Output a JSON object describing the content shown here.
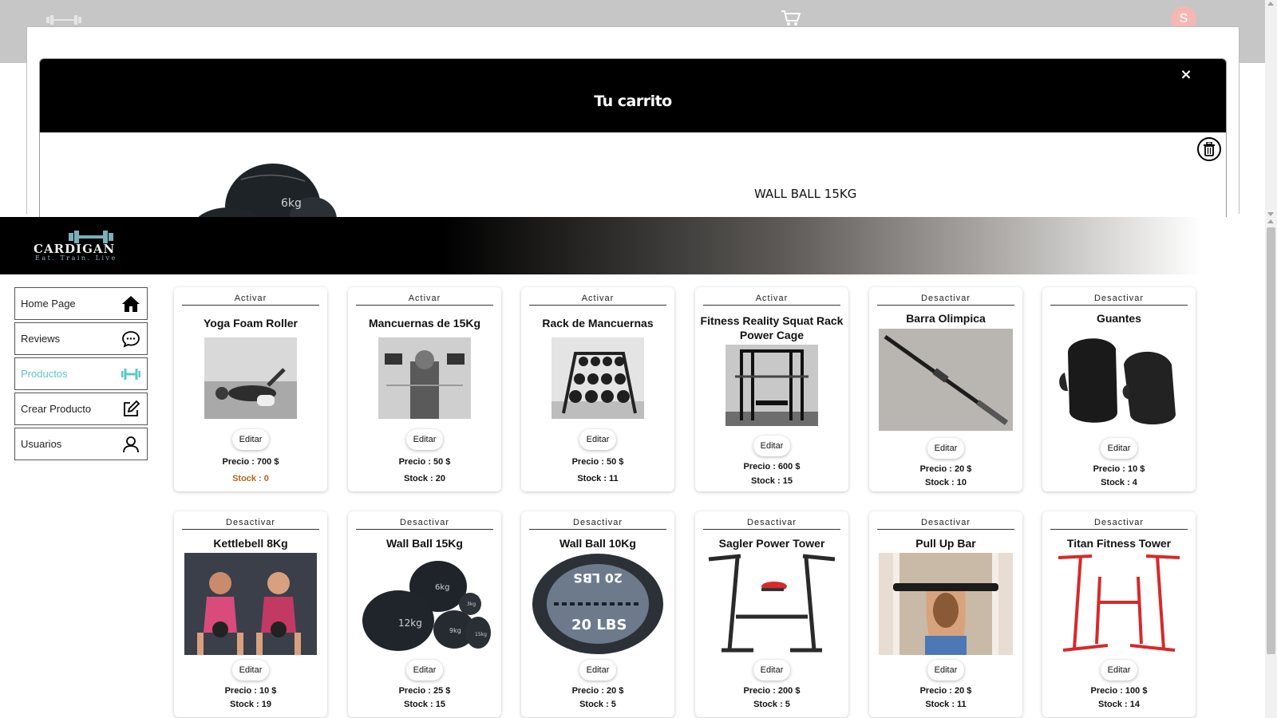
{
  "topnav": {
    "avatar_letter": "S"
  },
  "cart_modal": {
    "title": "Tu carrito",
    "close_glyph": "×",
    "item_name": "WALL BALL 15KG",
    "item_badge": "6kg"
  },
  "brand": {
    "name": "CARDIGAN",
    "tagline": "Eat. Train. Live"
  },
  "sidebar": {
    "items": [
      {
        "label": "Home Page",
        "icon": "home-icon"
      },
      {
        "label": "Reviews",
        "icon": "chat-icon"
      },
      {
        "label": "Productos",
        "icon": "dumbbell-icon",
        "active": true
      },
      {
        "label": "Crear Producto",
        "icon": "edit-icon"
      },
      {
        "label": "Usuarios",
        "icon": "user-icon"
      }
    ]
  },
  "products": [
    {
      "toggle": "Activar",
      "name": "Yoga Foam Roller",
      "edit": "Editar",
      "price": "Precio : 700 $",
      "stock": "Stock : 0"
    },
    {
      "toggle": "Activar",
      "name": "Mancuernas de 15Kg",
      "edit": "Editar",
      "price": "Precio : 50 $",
      "stock": "Stock : 20"
    },
    {
      "toggle": "Activar",
      "name": "Rack de Mancuernas",
      "edit": "Editar",
      "price": "Precio : 50 $",
      "stock": "Stock : 11"
    },
    {
      "toggle": "Activar",
      "name": "Fitness Reality Squat Rack Power Cage",
      "edit": "Editar",
      "price": "Precio : 600 $",
      "stock": "Stock : 15"
    },
    {
      "toggle": "Desactivar",
      "name": "Barra Olimpica",
      "edit": "Editar",
      "price": "Precio : 20 $",
      "stock": "Stock : 10"
    },
    {
      "toggle": "Desactivar",
      "name": "Guantes",
      "edit": "Editar",
      "price": "Precio : 10 $",
      "stock": "Stock : 4"
    },
    {
      "toggle": "Desactivar",
      "name": "Kettlebell 8Kg",
      "edit": "Editar",
      "price": "Precio : 10 $",
      "stock": "Stock : 19"
    },
    {
      "toggle": "Desactivar",
      "name": "Wall Ball 15Kg",
      "edit": "Editar",
      "price": "Precio : 25 $",
      "stock": "Stock : 15"
    },
    {
      "toggle": "Desactivar",
      "name": "Wall Ball 10Kg",
      "edit": "Editar",
      "price": "Precio : 20 $",
      "stock": "Stock : 5"
    },
    {
      "toggle": "Desactivar",
      "name": "Sagler Power Tower",
      "edit": "Editar",
      "price": "Precio : 200 $",
      "stock": "Stock : 5"
    },
    {
      "toggle": "Desactivar",
      "name": "Pull Up Bar",
      "edit": "Editar",
      "price": "Precio : 20 $",
      "stock": "Stock : 11"
    },
    {
      "toggle": "Desactivar",
      "name": "Titan Fitness Tower",
      "edit": "Editar",
      "price": "Precio : 100 $",
      "stock": "Stock : 14"
    }
  ],
  "product_image_labels": {
    "wallball15_a": "6kg",
    "wallball15_b": "12kg",
    "wallball15_c": "9kg",
    "wallball15_d": "15kg",
    "wallball15_e": "3kg",
    "wallball10_top": "20 LBS",
    "wallball10_bottom": "20 LBS"
  },
  "colors": {
    "accent": "#5cc7c7",
    "stock_zero": "#b5651d",
    "header_bg": "#000000"
  }
}
